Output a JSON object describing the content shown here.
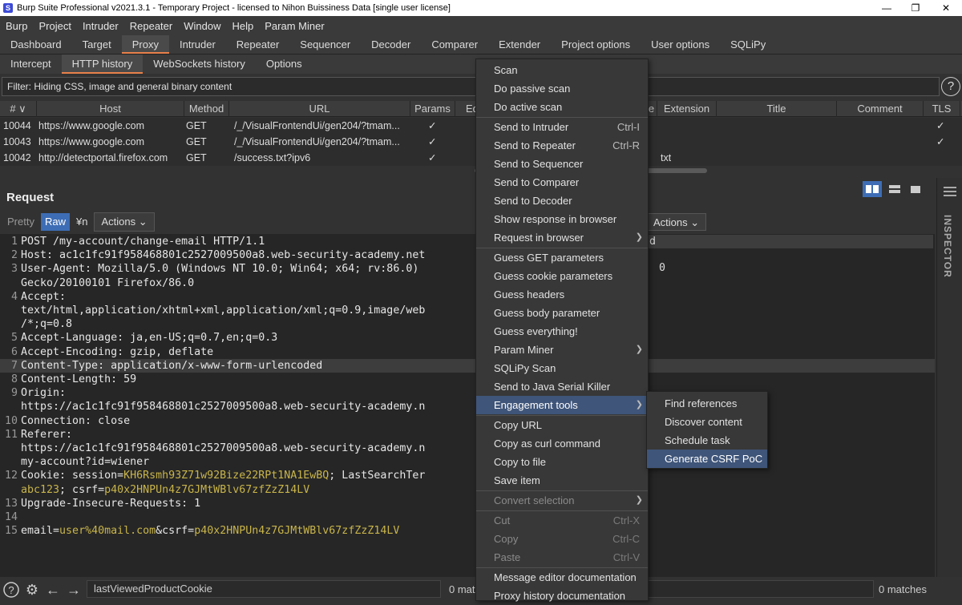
{
  "title": "Burp Suite Professional v2021.3.1 - Temporary Project - licensed to Nihon Buissiness Data [single user license]",
  "menu": [
    "Burp",
    "Project",
    "Intruder",
    "Repeater",
    "Window",
    "Help",
    "Param Miner"
  ],
  "main_tabs": [
    "Dashboard",
    "Target",
    "Proxy",
    "Intruder",
    "Repeater",
    "Sequencer",
    "Decoder",
    "Comparer",
    "Extender",
    "Project options",
    "User options",
    "SQLiPy"
  ],
  "sub_tabs": [
    "Intercept",
    "HTTP history",
    "WebSockets history",
    "Options"
  ],
  "filter": "Filter: Hiding CSS, image and general binary content",
  "columns": [
    "# ∨",
    "Host",
    "Method",
    "URL",
    "Params",
    "Ed",
    "e",
    "Extension",
    "Title",
    "Comment",
    "TLS"
  ],
  "rows": [
    {
      "num": "10044",
      "host": "https://www.google.com",
      "method": "GET",
      "url": "/_/VisualFrontendUi/gen204/?tmam...",
      "params": "✓",
      "ext": "",
      "tls": "✓"
    },
    {
      "num": "10043",
      "host": "https://www.google.com",
      "method": "GET",
      "url": "/_/VisualFrontendUi/gen204/?tmam...",
      "params": "✓",
      "ext": "",
      "tls": "✓"
    },
    {
      "num": "10042",
      "host": "http://detectportal.firefox.com",
      "method": "GET",
      "url": "/success.txt?ipv6",
      "params": "✓",
      "ext": "txt",
      "tls": ""
    }
  ],
  "request": {
    "title": "Request",
    "toolbar": {
      "pretty": "Pretty",
      "raw": "Raw",
      "newline": "¥n",
      "actions": "Actions"
    },
    "lines": [
      {
        "n": "1",
        "t": "POST /my-account/change-email HTTP/1.1"
      },
      {
        "n": "2",
        "t": "Host: ac1c1fc91f958468801c2527009500a8.web-security-academy.net"
      },
      {
        "n": "3",
        "t": "User-Agent: Mozilla/5.0 (Windows NT 10.0; Win64; x64; rv:86.0)"
      },
      {
        "n": "",
        "t": "Gecko/20100101 Firefox/86.0"
      },
      {
        "n": "4",
        "t": "Accept:"
      },
      {
        "n": "",
        "t": "text/html,application/xhtml+xml,application/xml;q=0.9,image/web"
      },
      {
        "n": "",
        "t": "/*;q=0.8"
      },
      {
        "n": "5",
        "t": "Accept-Language: ja,en-US;q=0.7,en;q=0.3"
      },
      {
        "n": "6",
        "t": "Accept-Encoding: gzip, deflate"
      },
      {
        "n": "7",
        "t": "Content-Type: application/x-www-form-urlencoded"
      },
      {
        "n": "8",
        "t": "Content-Length: 59"
      },
      {
        "n": "9",
        "t": "Origin:"
      },
      {
        "n": "",
        "t": "https://ac1c1fc91f958468801c2527009500a8.web-security-academy.n"
      },
      {
        "n": "10",
        "t": "Connection: close"
      },
      {
        "n": "11",
        "t": "Referer:"
      },
      {
        "n": "",
        "t": "https://ac1c1fc91f958468801c2527009500a8.web-security-academy.n"
      },
      {
        "n": "",
        "t": "my-account?id=wiener"
      },
      {
        "n": "12",
        "t": "Cookie: session=KH6Rsmh93Z71w92Bize22RPt1NA1EwBQ; LastSearchTer"
      },
      {
        "n": "",
        "t": "abc123; csrf=p40x2HNPUn4z7GJMtWBlv67zfZzZ14LV"
      },
      {
        "n": "13",
        "t": "Upgrade-Insecure-Requests: 1"
      },
      {
        "n": "14",
        "t": ""
      },
      {
        "n": "15",
        "t": "email=user%40mail.com&csrf=p40x2HNPUn4z7GJMtWBlv67zfZzZ14LV"
      }
    ]
  },
  "response": {
    "actions": "Actions",
    "line1": "d",
    "line2": "0"
  },
  "inspector": "INSPECTOR",
  "bottom": {
    "search_value": "lastViewedProductCookie",
    "matches_left": "0 mat",
    "matches_right": "0 matches"
  },
  "context_menu": [
    {
      "label": "Scan"
    },
    {
      "label": "Do passive scan"
    },
    {
      "label": "Do active scan"
    },
    {
      "sep": true
    },
    {
      "label": "Send to Intruder",
      "shortcut": "Ctrl-I"
    },
    {
      "label": "Send to Repeater",
      "shortcut": "Ctrl-R"
    },
    {
      "label": "Send to Sequencer"
    },
    {
      "label": "Send to Comparer"
    },
    {
      "label": "Send to Decoder"
    },
    {
      "label": "Show response in browser"
    },
    {
      "label": "Request in browser",
      "submenu": true
    },
    {
      "sep": true
    },
    {
      "label": "Guess GET parameters"
    },
    {
      "label": "Guess cookie parameters"
    },
    {
      "label": "Guess headers"
    },
    {
      "label": "Guess body parameter"
    },
    {
      "label": "Guess everything!"
    },
    {
      "label": "Param Miner",
      "submenu": true
    },
    {
      "label": "SQLiPy Scan"
    },
    {
      "label": "Send to Java Serial Killer"
    },
    {
      "label": "Engagement tools",
      "submenu": true,
      "active": true
    },
    {
      "sep": true
    },
    {
      "label": "Copy URL"
    },
    {
      "label": "Copy as curl command"
    },
    {
      "label": "Copy to file"
    },
    {
      "label": "Save item"
    },
    {
      "sep": true
    },
    {
      "label": "Convert selection",
      "submenu": true,
      "disabled": true
    },
    {
      "sep": true
    },
    {
      "label": "Cut",
      "shortcut": "Ctrl-X",
      "disabled": true
    },
    {
      "label": "Copy",
      "shortcut": "Ctrl-C",
      "disabled": true
    },
    {
      "label": "Paste",
      "shortcut": "Ctrl-V",
      "disabled": true
    },
    {
      "sep": true
    },
    {
      "label": "Message editor documentation"
    },
    {
      "label": "Proxy history documentation"
    }
  ],
  "submenu": [
    "Find references",
    "Discover content",
    "Schedule task",
    "Generate CSRF PoC"
  ]
}
